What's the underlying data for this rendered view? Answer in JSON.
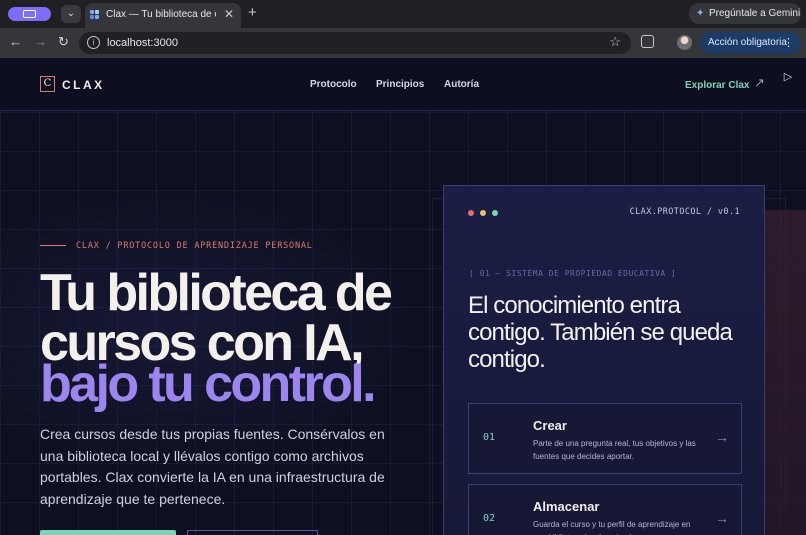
{
  "browser": {
    "tab_title": "Clax — Tu biblioteca de curso",
    "gemini_label": "Pregúntale a Gemini",
    "url": "localhost:3000",
    "action_label": "Acción obligatoria"
  },
  "site": {
    "logo_mark": "C",
    "logo_text": "CLAX",
    "nav": [
      "Protocolo",
      "Principios",
      "Autoría"
    ],
    "explore": "Explorar Clax"
  },
  "hero": {
    "eyebrow": "CLAX / PROTOCOLO DE APRENDIZAJE PERSONAL",
    "title_line1": "Tu biblioteca de",
    "title_line2": "cursos con IA,",
    "title_line3": "bajo tu control.",
    "lede": "Crea cursos desde tus propias fuentes. Consérvalos en una biblioteca local y llévalos contigo como archivos portables. Clax convierte la IA en una infraestructura de aprendizaje que te pertenece."
  },
  "card": {
    "protocol": "CLAX.PROTOCOL / v0.1",
    "section": "[ 01 — SISTEMA DE PROPIEDAD EDUCATIVA ]",
    "title": "El conocimiento entra contigo. También se queda contigo.",
    "dots": [
      "#e0706a",
      "#e8c46a",
      "#7fd3b4"
    ],
    "steps": [
      {
        "num": "01",
        "name": "Crear",
        "desc": "Parte de una pregunta real, tus objetivos y las fuentes que decides aportar."
      },
      {
        "num": "02",
        "name": "Almacenar",
        "desc": "Guarda el curso y tu perfil de aprendizaje en una biblioteca local y privada."
      }
    ]
  },
  "colors": {
    "accent_green": "#7fd3b4",
    "accent_purple": "#9c86ee",
    "accent_coral": "#e07a6a",
    "background": "#0e1022"
  }
}
